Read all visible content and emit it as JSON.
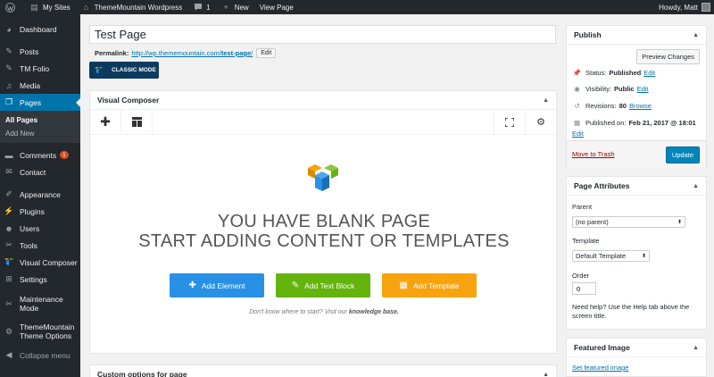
{
  "adminbar": {
    "my_sites": "My Sites",
    "site_name": "ThemeMountain Wordpress",
    "comments_count": "1",
    "new_label": "New",
    "view_page": "View Page",
    "howdy": "Howdy, Matt"
  },
  "sidebar": {
    "items": [
      {
        "label": "Dashboard",
        "icon": "dashboard-icon"
      },
      {
        "label": "Posts",
        "icon": "pushpin-icon"
      },
      {
        "label": "TM Folio",
        "icon": "pushpin-icon"
      },
      {
        "label": "Media",
        "icon": "media-icon"
      },
      {
        "label": "Pages",
        "icon": "pages-icon"
      },
      {
        "label": "Comments",
        "icon": "comment-icon",
        "badge": "1"
      },
      {
        "label": "Contact",
        "icon": "envelope-icon"
      },
      {
        "label": "Appearance",
        "icon": "brush-icon"
      },
      {
        "label": "Plugins",
        "icon": "plug-icon"
      },
      {
        "label": "Users",
        "icon": "users-icon"
      },
      {
        "label": "Tools",
        "icon": "wrench-icon"
      },
      {
        "label": "Visual Composer",
        "icon": "vc-icon"
      },
      {
        "label": "Settings",
        "icon": "settings-icon"
      },
      {
        "label": "Maintenance Mode",
        "icon": "wrench-icon"
      },
      {
        "label": "ThemeMountain Theme Options",
        "icon": "gear-icon"
      }
    ],
    "submenu": [
      "All Pages",
      "Add New"
    ],
    "collapse": "Collapse menu"
  },
  "editor": {
    "title_value": "Test Page",
    "permalink_label": "Permalink:",
    "permalink_base": "http://wp.thememountain.com/",
    "permalink_slug": "test-page",
    "permalink_edit": "Edit",
    "classic_mode": "CLASSIC MODE"
  },
  "vc": {
    "title": "Visual Composer",
    "blank_line1": "YOU HAVE BLANK PAGE",
    "blank_line2": "START ADDING CONTENT OR TEMPLATES",
    "add_element": "Add Element",
    "add_text_block": "Add Text Block",
    "add_template": "Add Template",
    "help_prefix": "Don't know where to start? Visit our",
    "help_link": "knowledge base.",
    "colors": {
      "element": "#2891e6",
      "text_block": "#65b30d",
      "template": "#f7a30e"
    }
  },
  "custom_options": {
    "title": "Custom options for page"
  },
  "publish": {
    "title": "Publish",
    "preview": "Preview Changes",
    "status_label": "Status:",
    "status_value": "Published",
    "visibility_label": "Visibility:",
    "visibility_value": "Public",
    "revisions_label": "Revisions:",
    "revisions_value": "80",
    "browse": "Browse",
    "published_label": "Published on:",
    "published_value": "Feb 21, 2017 @ 18:01",
    "edit": "Edit",
    "trash": "Move to Trash",
    "update": "Update"
  },
  "attributes": {
    "title": "Page Attributes",
    "parent_label": "Parent",
    "parent_value": "(no parent)",
    "template_label": "Template",
    "template_value": "Default Template",
    "order_label": "Order",
    "order_value": "0",
    "help": "Need help? Use the Help tab above the screen title."
  },
  "featured": {
    "title": "Featured Image",
    "set_link": "Set featured image"
  }
}
